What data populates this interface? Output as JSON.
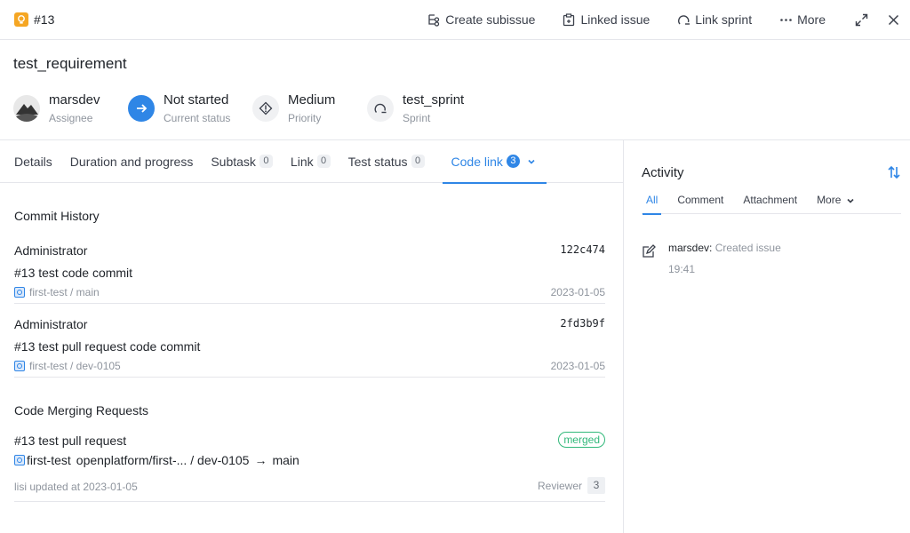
{
  "header": {
    "issue_id": "#13",
    "actions": {
      "create_subissue": "Create subissue",
      "linked_issue": "Linked issue",
      "link_sprint": "Link sprint",
      "more": "More"
    }
  },
  "title": "test_requirement",
  "fields": {
    "assignee": {
      "value": "marsdev",
      "label": "Assignee"
    },
    "status": {
      "value": "Not started",
      "label": "Current status"
    },
    "priority": {
      "value": "Medium",
      "label": "Priority"
    },
    "sprint": {
      "value": "test_sprint",
      "label": "Sprint"
    }
  },
  "tabs": [
    {
      "label": "Details"
    },
    {
      "label": "Duration and progress"
    },
    {
      "label": "Subtask",
      "count": "0"
    },
    {
      "label": "Link",
      "count": "0"
    },
    {
      "label": "Test status",
      "count": "0"
    },
    {
      "label": "Code link",
      "count": "3"
    }
  ],
  "commit_history": {
    "title": "Commit History",
    "commits": [
      {
        "author": "Administrator",
        "hash": "122c474",
        "message": "#13 test code commit",
        "repo": "first-test / main",
        "date": "2023-01-05"
      },
      {
        "author": "Administrator",
        "hash": "2fd3b9f",
        "message": "#13 test pull request code commit",
        "repo": "first-test / dev-0105",
        "date": "2023-01-05"
      }
    ]
  },
  "merge_requests": {
    "title": "Code Merging Requests",
    "items": [
      {
        "title": "#13 test pull request",
        "status": "merged",
        "repo": "first-test",
        "source": "openplatform/first-...",
        "branch": "/ dev-0105",
        "arrow": "→",
        "target": "main",
        "updated": "lisi updated at 2023-01-05",
        "reviewer_label": "Reviewer",
        "reviewer_count": "3"
      }
    ]
  },
  "activity": {
    "title": "Activity",
    "tabs": [
      "All",
      "Comment",
      "Attachment",
      "More"
    ],
    "entries": [
      {
        "user": "marsdev:",
        "action": "Created issue",
        "time": "19:41"
      }
    ]
  },
  "colors": {
    "accent": "#2f86e6",
    "merged": "#31b87a",
    "bulb": "#f5a623"
  }
}
